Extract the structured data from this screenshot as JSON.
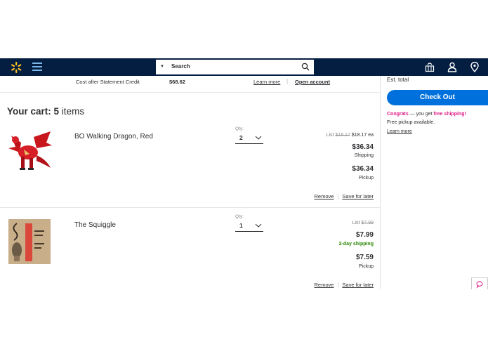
{
  "header": {
    "search_placeholder": "Search",
    "brand_color": "#041e42",
    "spark_color": "#ffc220",
    "icons": [
      "spark-logo",
      "menu-icon",
      "search-icon",
      "reorder-icon",
      "account-icon",
      "location-icon"
    ]
  },
  "credit": {
    "label": "Cost after Statement Credit",
    "value": "$68.62",
    "learn_more": "Learn more",
    "separator": "|",
    "open_account": "Open account"
  },
  "cart": {
    "title_prefix": "Your cart:",
    "count": "5",
    "title_suffix": "items"
  },
  "items": [
    {
      "name": "BO Walking Dragon, Red",
      "qty_label": "Qty:",
      "qty": "2",
      "list_label": "List",
      "list_price": "$18.17",
      "unit_price": "$18.17 ea",
      "price_1": "$36.34",
      "price_1_label": "Shipping",
      "price_2": "$36.34",
      "price_2_label": "Pickup",
      "remove": "Remove",
      "separator": "|",
      "save_for_later": "Save for later"
    },
    {
      "name": "The Squiggle",
      "qty_label": "Qty:",
      "qty": "1",
      "list_label": "List",
      "list_price": "$7.99",
      "price_1": "$7.99",
      "price_1_label": "2-day shipping",
      "price_2": "$7.59",
      "price_2_label": "Pickup",
      "remove": "Remove",
      "separator": "|",
      "save_for_later": "Save for later"
    }
  ],
  "summary": {
    "est_total": "Est. total",
    "checkout": "Check Out",
    "congrats": "Congrats",
    "congrats_mid": " — you get ",
    "free_shipping": "free shipping!",
    "pickup_note": "Free pickup available.",
    "learn_more": "Learn more",
    "accent": "#0071dc",
    "promo_color": "#de1c85"
  }
}
